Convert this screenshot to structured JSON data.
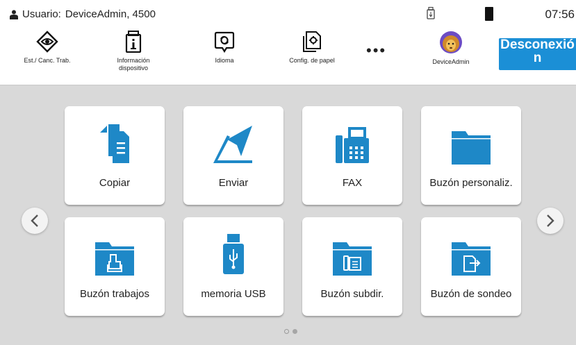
{
  "header": {
    "user_label": "Usuario:",
    "user_value": "DeviceAdmin, 4500",
    "time": "07:56"
  },
  "quick_access": [
    {
      "label": "Est./ Canc. Trab.",
      "icon": "job-status-icon"
    },
    {
      "label": "Información dispositivo",
      "icon": "device-info-icon"
    },
    {
      "label": "Idioma",
      "icon": "language-icon"
    },
    {
      "label": "Config. de papel",
      "icon": "paper-settings-icon"
    },
    {
      "label": "•••",
      "icon": "more-icon"
    },
    {
      "label": "DeviceAdmin",
      "icon": "avatar-icon"
    }
  ],
  "logout": {
    "line1": "Desconexió",
    "line2": "n"
  },
  "tiles": [
    {
      "label": "Copiar",
      "icon": "copy-icon"
    },
    {
      "label": "Enviar",
      "icon": "send-icon"
    },
    {
      "label": "FAX",
      "icon": "fax-icon"
    },
    {
      "label": "Buzón personaliz.",
      "icon": "custom-box-icon"
    },
    {
      "label": "Buzón trabajos",
      "icon": "job-box-icon"
    },
    {
      "label": "memoria USB",
      "icon": "usb-icon"
    },
    {
      "label": "Buzón subdir.",
      "icon": "subaddress-box-icon"
    },
    {
      "label": "Buzón de sondeo",
      "icon": "polling-box-icon"
    }
  ],
  "pagination": {
    "current": 1,
    "total": 2
  },
  "colors": {
    "accent": "#1b8fd6",
    "icon_blue": "#1e88c7",
    "background": "#d9d9d9"
  }
}
